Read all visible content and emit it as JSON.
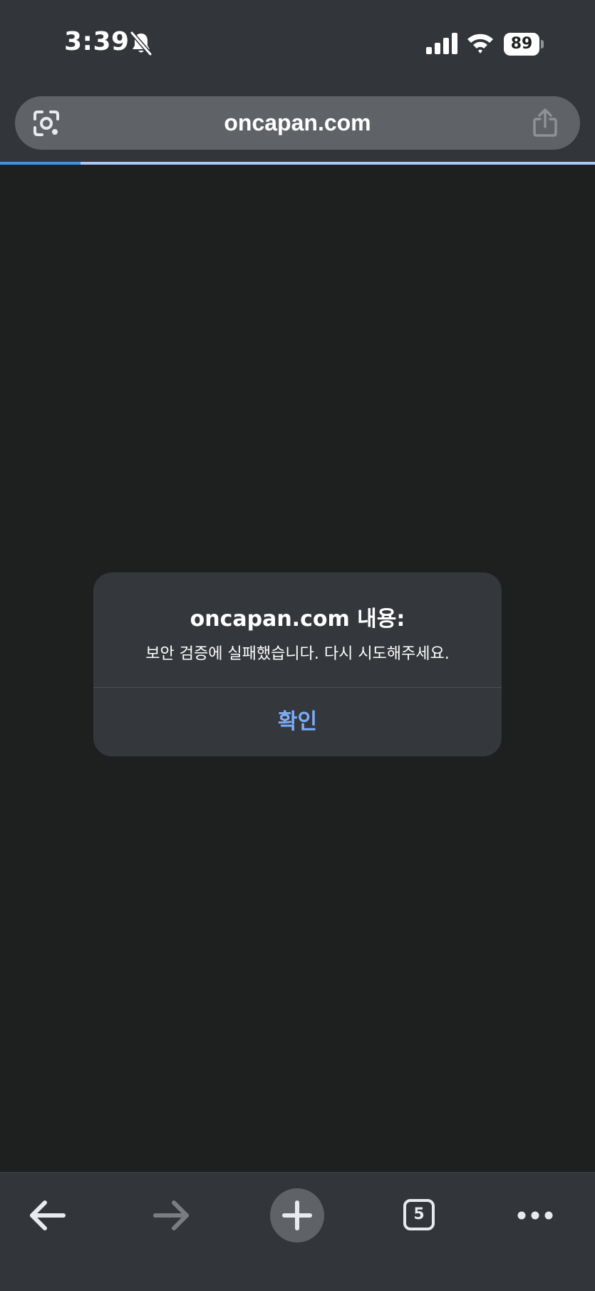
{
  "status_bar": {
    "time": "3:39",
    "battery_level": "89",
    "icons": [
      "bell-slash-icon",
      "cellular-signal-icon",
      "wifi-icon",
      "battery-icon"
    ]
  },
  "browser": {
    "url": "oncapan.com",
    "load_progress_percent": 13.5,
    "icons": {
      "left": "lens-camera-icon",
      "right": "share-icon"
    }
  },
  "dialog": {
    "title": "oncapan.com 내용:",
    "message": "보안 검증에 실패했습니다. 다시 시도해주세요.",
    "confirm_label": "확인"
  },
  "toolbar": {
    "tab_count": "5",
    "items": [
      "back-arrow-icon",
      "forward-arrow-icon",
      "plus-icon",
      "tab-switcher-icon",
      "more-dots-icon"
    ]
  },
  "colors": {
    "chrome": "#32353a",
    "content_bg": "#1e1f1f",
    "url_pill": "#5f6368",
    "dialog_bg": "#34373b",
    "accent_blue": "#7cacf8",
    "progress_fill": "#4a90e2",
    "progress_track": "#a8c7fa"
  }
}
